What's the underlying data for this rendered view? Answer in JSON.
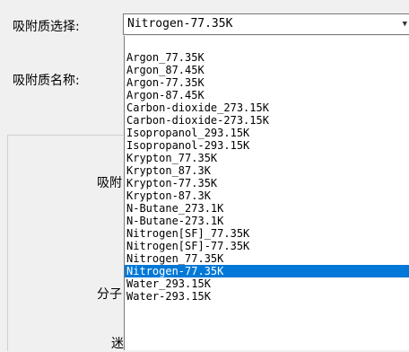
{
  "form": {
    "adsorbate_select_label": "吸附质选择:",
    "adsorbate_name_label": "吸附质名称:",
    "partial_label_1": "吸附",
    "partial_label_2": "分子",
    "partial_label_3": "迷"
  },
  "combo": {
    "selected_value": "Nitrogen-77.35K",
    "arrow_icon": "chevron-down-icon"
  },
  "dropdown": {
    "options": [
      "Argon_77.35K",
      "Argon_87.45K",
      "Argon-77.35K",
      "Argon-87.45K",
      "Carbon-dioxide_273.15K",
      "Carbon-dioxide-273.15K",
      "Isopropanol_293.15K",
      "Isopropanol-293.15K",
      "Krypton_77.35K",
      "Krypton_87.3K",
      "Krypton-77.35K",
      "Krypton-87.3K",
      "N-Butane_273.1K",
      "N-Butane-273.1K",
      "Nitrogen[SF]_77.35K",
      "Nitrogen[SF]-77.35K",
      "Nitrogen_77.35K",
      "Nitrogen-77.35K",
      "Water_293.15K",
      "Water-293.15K"
    ],
    "selected_index": 17
  }
}
